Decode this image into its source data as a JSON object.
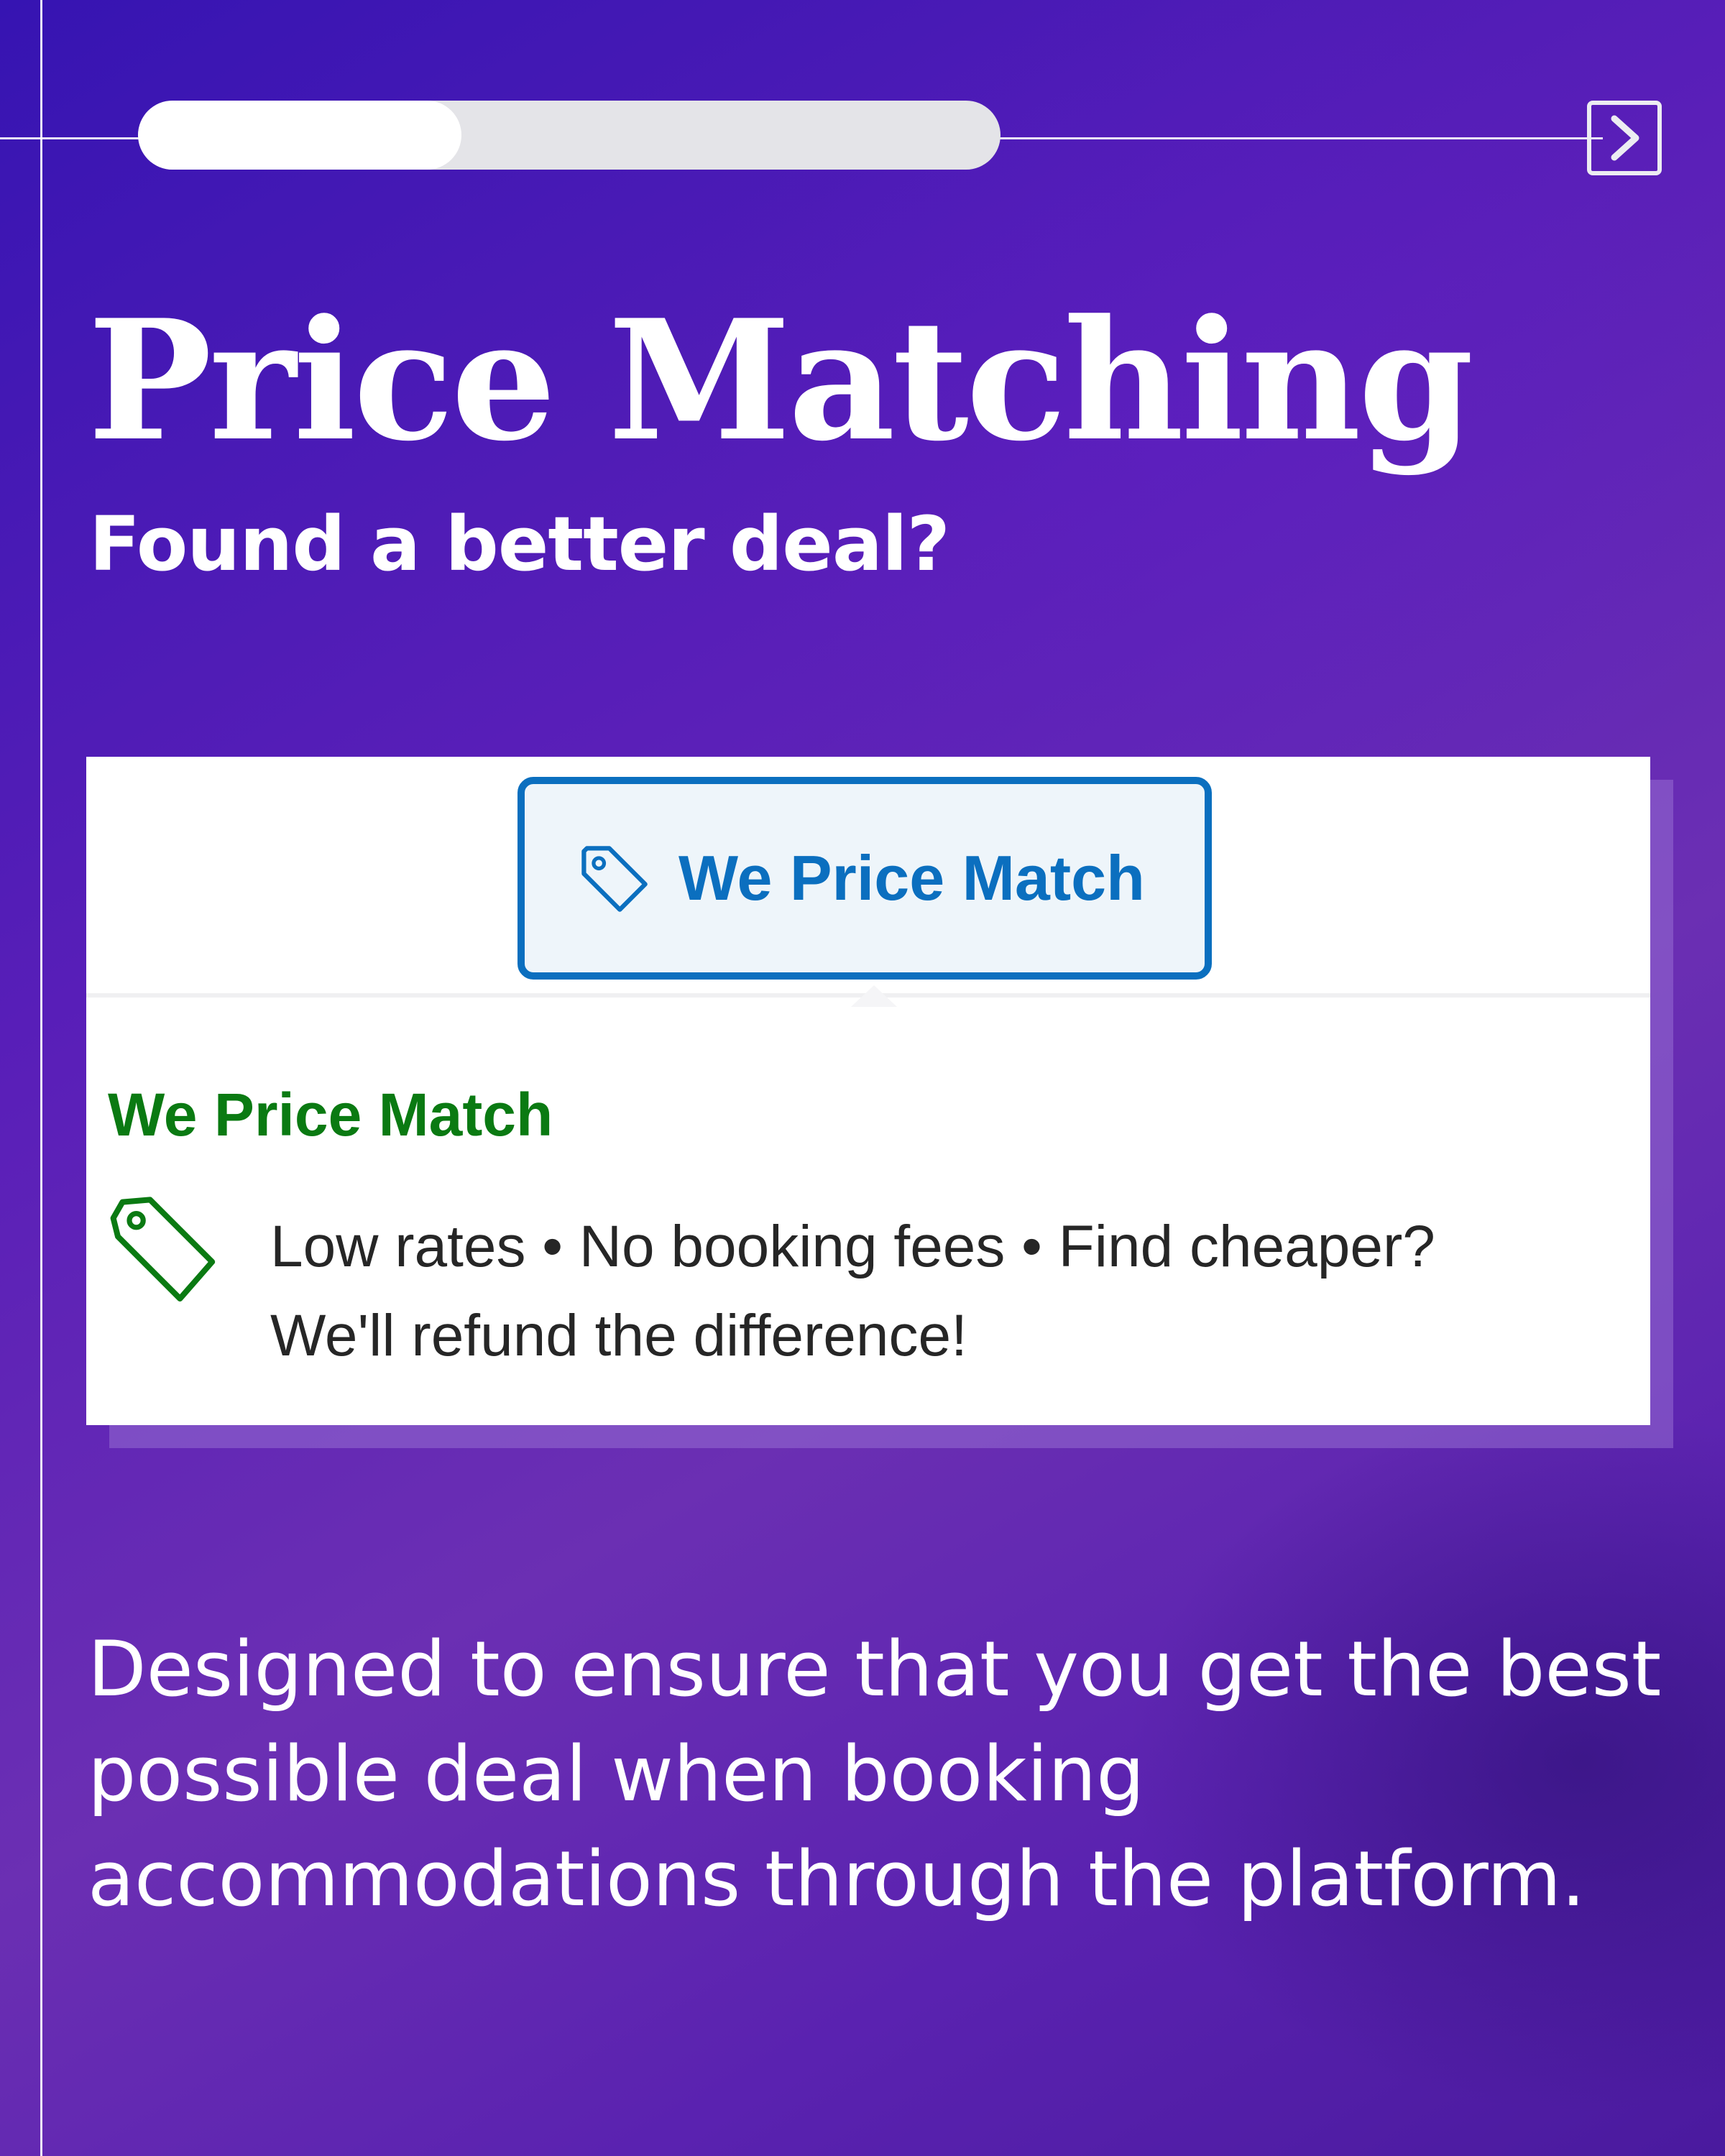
{
  "progress": {
    "value": 0.375
  },
  "header": {
    "title": "Price Matching",
    "subtitle": "Found a better deal?"
  },
  "card": {
    "button_label": "We Price Match",
    "popup_heading": "We Price Match",
    "popup_line1": "Low rates • No booking fees • Find cheaper?",
    "popup_line2": "We'll refund the difference!"
  },
  "body": {
    "line1": "Designed to ensure that you get the best",
    "line2": "possible deal when booking",
    "line3": "accommodations through the platform."
  },
  "icons": {
    "next": "chevron-right-icon",
    "tag": "price-tag-icon"
  },
  "colors": {
    "button_blue": "#0b6fbf",
    "heading_green": "#0a7a12",
    "background_purple": "#5a1fb8"
  }
}
